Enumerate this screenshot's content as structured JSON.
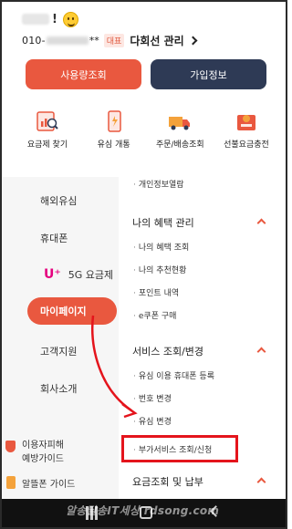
{
  "header": {
    "exclaim": "!",
    "phone_prefix": "010-",
    "phone_suffix": "**",
    "badge": "대표",
    "line_manage": "다회선 관리",
    "buttons": {
      "usage": "사용량조회",
      "join": "가입정보"
    },
    "quick_menu": [
      {
        "label": "요금제 찾기",
        "icon": "search-plan-icon"
      },
      {
        "label": "유심 개통",
        "icon": "usim-activation-icon"
      },
      {
        "label": "주문/배송조회",
        "icon": "delivery-truck-icon"
      },
      {
        "label": "선불요금충전",
        "icon": "prepaid-charge-icon"
      }
    ]
  },
  "left_nav": {
    "items": [
      "해외유심",
      "휴대폰",
      "5G 요금제",
      "마이페이지",
      "고객지원",
      "회사소개"
    ],
    "uplus_logo": "U⁺",
    "active": "마이페이지",
    "bottom_links": [
      "이용자피해\n예방가이드",
      "알뜰폰 가이드"
    ]
  },
  "right_panel": {
    "item_personal_info": "개인정보열람",
    "section_benefits": "나의 혜택 관리",
    "benefit_items": [
      "나의 혜택 조회",
      "나의 추천현황",
      "포인트 내역",
      "e쿠폰 구매"
    ],
    "section_service": "서비스 조회/변경",
    "service_items": [
      "유심 이용 휴대폰 등록",
      "번호 변경",
      "유심 변경",
      "부가서비스 조회/신청"
    ],
    "section_billing": "요금조회 및 납부"
  },
  "watermark": "알송달송IT세상 rdsong.com",
  "colors": {
    "accent": "#e9583f",
    "navy": "#2e3a55",
    "highlight": "#e4141c"
  }
}
